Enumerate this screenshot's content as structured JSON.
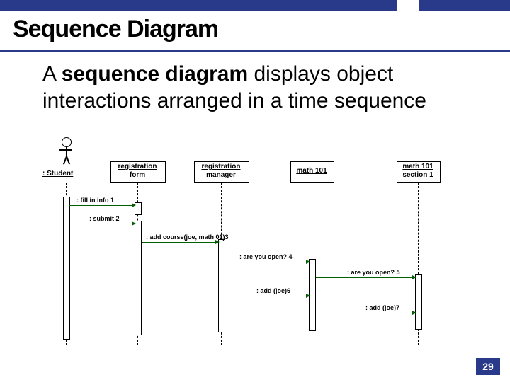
{
  "header": {
    "title": "Sequence Diagram"
  },
  "body": {
    "prefix": "A ",
    "bold": "sequence diagram",
    "suffix": " displays object interactions arranged in a time sequence"
  },
  "participants": {
    "student": ": Student",
    "regform_l1": "registration",
    "regform_l2": "form",
    "regmgr_l1": "registration",
    "regmgr_l2": "manager",
    "math101": "math 101",
    "math101s1_l1": "math 101",
    "math101s1_l2": "section 1"
  },
  "messages": {
    "m1": ": fill in info 1",
    "m2": ": submit 2",
    "m3": ": add course(joe, math 01)3",
    "m4": ": are you open? 4",
    "m5": ": are you open? 5",
    "m6": ": add (joe)6",
    "m7": ": add (joe)7"
  },
  "slide_number": "29",
  "colors": {
    "brand": "#2a3a8a",
    "arrow": "#006000"
  }
}
